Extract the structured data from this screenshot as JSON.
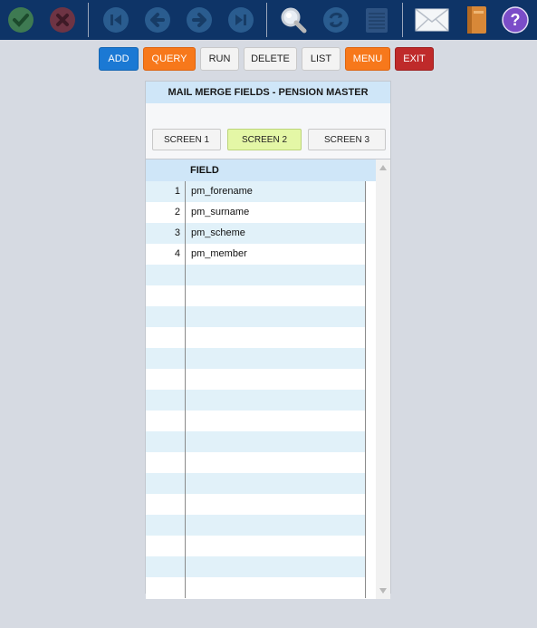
{
  "toolbar": {
    "icons": [
      "check-icon",
      "cancel-icon",
      "first-record-icon",
      "previous-record-icon",
      "next-record-icon",
      "last-record-icon",
      "search-icon",
      "refresh-icon",
      "notepad-icon",
      "mail-icon",
      "book-icon",
      "help-icon"
    ],
    "help_glyph": "?"
  },
  "actions": {
    "add": "ADD",
    "query": "QUERY",
    "run": "RUN",
    "delete": "DELETE",
    "list": "LIST",
    "menu": "MENU",
    "exit": "EXIT"
  },
  "panel": {
    "title": "MAIL MERGE FIELDS - PENSION MASTER",
    "screens": [
      "SCREEN 1",
      "SCREEN 2",
      "SCREEN 3"
    ],
    "active_screen": "SCREEN 2",
    "grid": {
      "column_header": "FIELD",
      "rows": [
        {
          "num": "1",
          "field": "pm_forename"
        },
        {
          "num": "2",
          "field": "pm_surname"
        },
        {
          "num": "3",
          "field": "pm_scheme"
        },
        {
          "num": "4",
          "field": "pm_member"
        }
      ],
      "empty_row_count": 16
    }
  },
  "colors": {
    "toolbar_bg": "#0e3467",
    "add": "#1b79d4",
    "query": "#f7781b",
    "menu": "#f7781b",
    "exit": "#bf2a2a",
    "active_screen": "#e4f7a6",
    "row_alt": "#e1f1f9",
    "header": "#cfe6f8"
  }
}
